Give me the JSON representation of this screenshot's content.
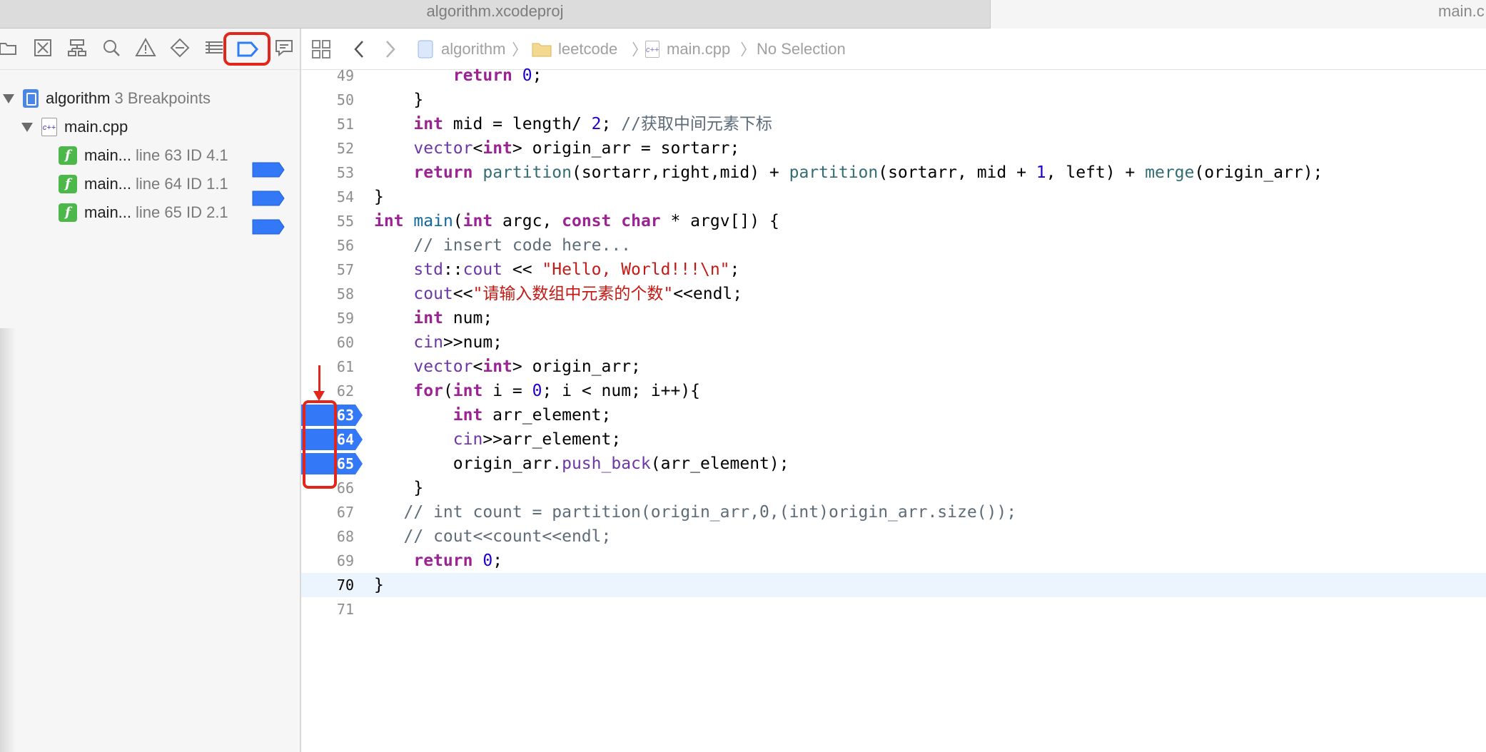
{
  "tabs": [
    {
      "label": "algorithm.xcodeproj"
    },
    {
      "label": "main.c"
    }
  ],
  "navigator": {
    "toolbar_icons": [
      "folder-icon",
      "source-control-icon",
      "hierarchy-icon",
      "search-icon",
      "warning-icon",
      "test-icon",
      "debug-icon",
      "breakpoint-icon",
      "report-icon"
    ],
    "project": {
      "name": "algorithm",
      "detail": "3 Breakpoints"
    },
    "file": {
      "name": "main.cpp"
    },
    "breakpoints": [
      {
        "name": "main...",
        "detail": "line 63 ID 4.1"
      },
      {
        "name": "main...",
        "detail": "line 64 ID 1.1"
      },
      {
        "name": "main...",
        "detail": "line 65 ID 2.1"
      }
    ]
  },
  "jumpbar": {
    "crumbs": [
      "algorithm",
      "leetcode",
      "main.cpp",
      "No Selection"
    ]
  },
  "editor": {
    "lines": [
      49,
      50,
      51,
      52,
      53,
      54,
      55,
      56,
      57,
      58,
      59,
      60,
      61,
      62,
      63,
      64,
      65,
      66,
      67,
      68,
      69,
      70,
      71
    ],
    "breakpoint_lines": [
      63,
      64,
      65
    ],
    "current_line": 70,
    "code": {
      "l51_comment": "//获取中间元素下标",
      "l56_comment": "// insert code here...",
      "l57_string": "\"Hello, World!!!\\n\"",
      "l58_string": "\"请输入数组中元素的个数\"",
      "l67_comment": "// int count = partition(origin_arr,0,(int)origin_arr.size());",
      "l68_comment": "// cout<<count<<endl;"
    }
  },
  "colors": {
    "breakpoint": "#3378f6",
    "annotation": "#e3261b"
  }
}
